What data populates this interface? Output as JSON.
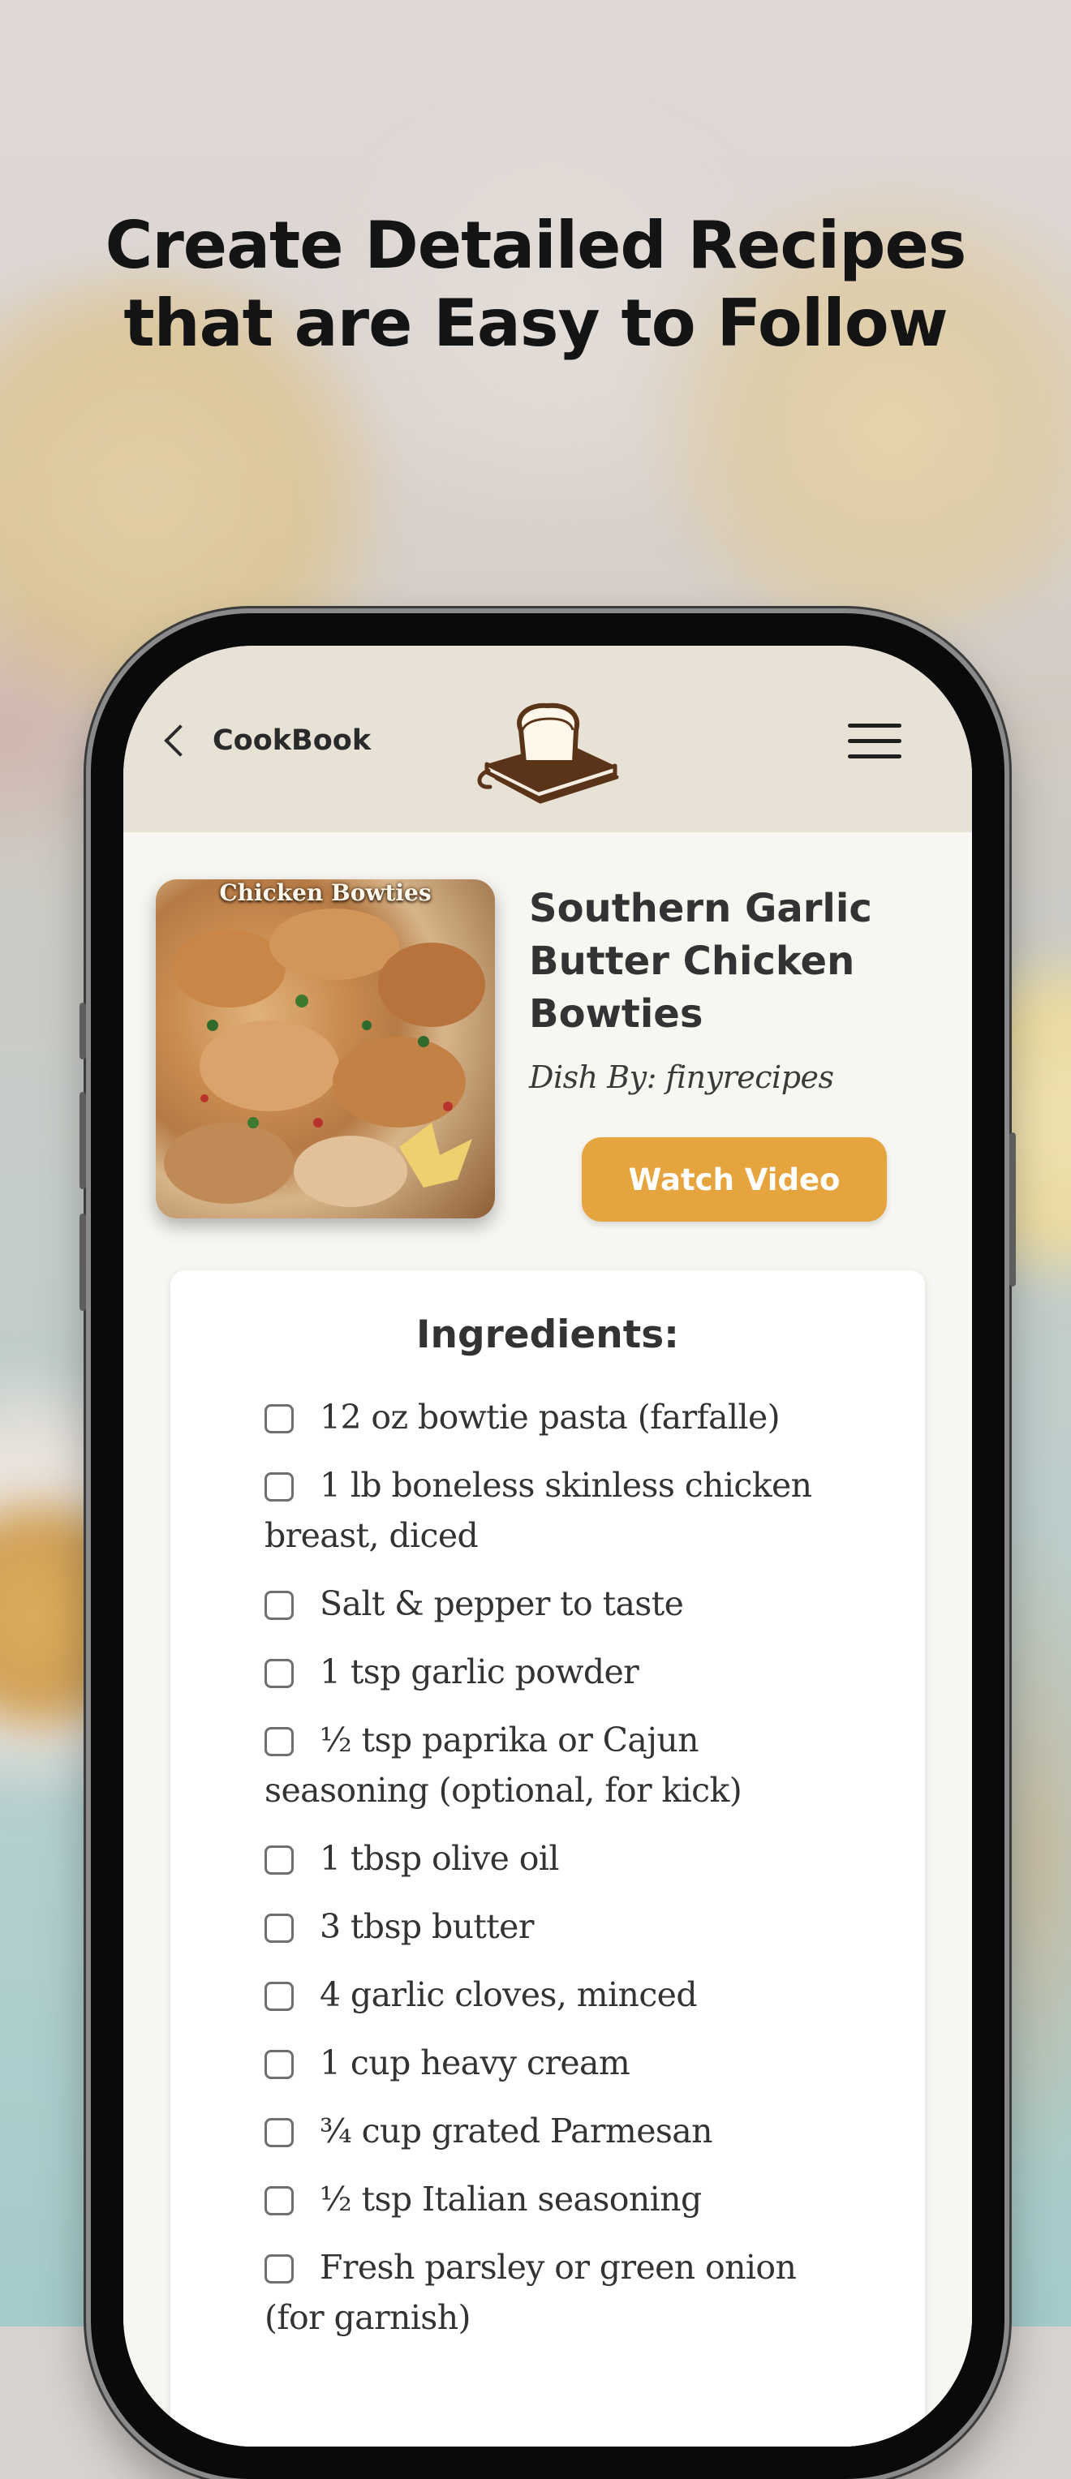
{
  "headline": {
    "line1": "Create Detailed Recipes",
    "line2": "that are Easy to Follow"
  },
  "appbar": {
    "back_label": "CookBook",
    "back_icon": "chevron-left-icon",
    "logo_icon": "bread-on-book-logo",
    "menu_icon": "hamburger-menu-icon"
  },
  "recipe": {
    "image_caption": "Chicken Bowties",
    "title": "Southern Garlic Butter Chicken Bowties",
    "byline": "Dish By: finyrecipes",
    "watch_label": "Watch Video"
  },
  "ingredients": {
    "heading": "Ingredients:",
    "items": [
      "12 oz bowtie pasta (farfalle)",
      "1 lb boneless skinless chicken breast, diced",
      "Salt & pepper to taste",
      "1 tsp garlic powder",
      "½ tsp paprika or Cajun seasoning (optional, for kick)",
      "1 tbsp olive oil",
      "3 tbsp butter",
      "4 garlic cloves, minced",
      "1 cup heavy cream",
      "¾ cup grated Parmesan",
      "½ tsp Italian seasoning",
      "Fresh parsley or green onion (for garnish)"
    ]
  },
  "colors": {
    "accent": "#e5a43e",
    "appbar_bg": "#e8e1d6",
    "screen_bg": "#f8f6f1",
    "logo_brown": "#5a3418"
  }
}
